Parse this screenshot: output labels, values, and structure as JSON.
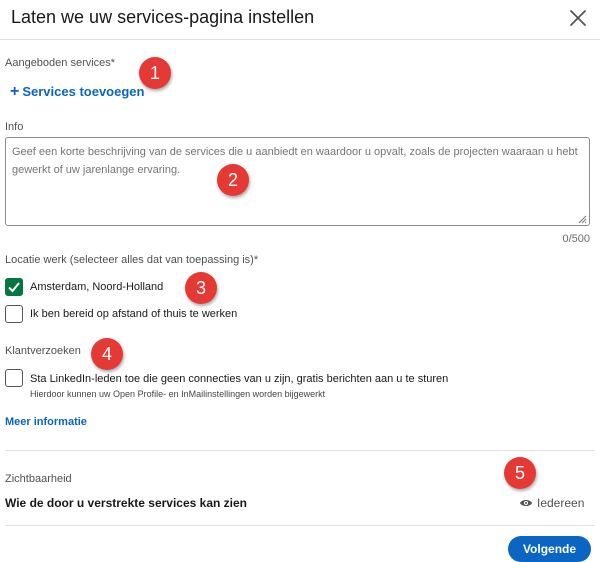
{
  "dialog": {
    "title": "Laten we uw services-pagina instellen",
    "close_icon": "close-icon"
  },
  "services": {
    "label": "Aangeboden services*",
    "add_plus": "+",
    "add_label": "Services toevoegen"
  },
  "info": {
    "label": "Info",
    "placeholder": "Geef een korte beschrijving van de services die u aanbiedt en waardoor u opvalt, zoals de projecten waaraan u hebt gewerkt of uw jarenlange ervaring.",
    "value": "",
    "counter": "0/500"
  },
  "location": {
    "label": "Locatie werk (selecteer alles dat van toepassing is)*",
    "options": [
      {
        "label": "Amsterdam, Noord-Holland",
        "checked": true
      },
      {
        "label": "Ik ben bereid op afstand of thuis te werken",
        "checked": false
      }
    ]
  },
  "requests": {
    "label": "Klantverzoeken",
    "option_label": "Sta LinkedIn-leden toe die geen connecties van u zijn, gratis berichten aan u te sturen",
    "option_sub": "Hierdoor kunnen uw Open Profile- en InMailinstellingen worden bijgewerkt",
    "checked": false,
    "more_link": "Meer informatie"
  },
  "visibility": {
    "label": "Zichtbaarheid",
    "title": "Wie de door u verstrekte services kan zien",
    "value": "Iedereen",
    "icon": "eye-icon"
  },
  "footer": {
    "next_label": "Volgende"
  },
  "annotations": [
    "1",
    "2",
    "3",
    "4",
    "5"
  ],
  "colors": {
    "accent": "#0a66c2",
    "check_green": "#057642",
    "badge_red": "#e53935"
  }
}
